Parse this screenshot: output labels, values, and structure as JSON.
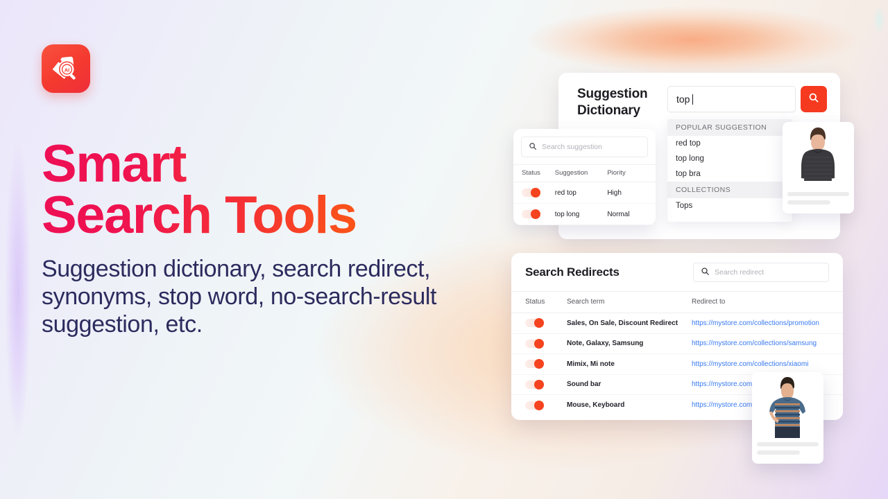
{
  "brand": {
    "logo_icon": "tag-ai-search-icon",
    "logo_bg": "#F4392F"
  },
  "hero": {
    "headline_line1": "Smart",
    "headline_line2": "Search Tools",
    "headline_gradient_from": "#EE0F55",
    "headline_gradient_to": "#FB5517",
    "subheadline": "Suggestion dictionary, search redirect, synonyms, stop word, no-search-result suggestion, etc.",
    "subheadline_color": "#2C2B5E"
  },
  "suggestion_dictionary": {
    "title_line1": "Suggestion",
    "title_line2": "Dictionary",
    "storefront_search": {
      "value": "top",
      "button_icon": "search-icon",
      "button_color": "#F53A20"
    },
    "dropdown": {
      "sections": [
        {
          "heading": "POPULAR SUGGESTION",
          "items": [
            "red top",
            "top long",
            "top bra"
          ]
        },
        {
          "heading": "COLLECTIONS",
          "items": [
            "Tops"
          ]
        }
      ]
    },
    "table": {
      "search_placeholder": "Search suggestion",
      "search_icon": "search-icon",
      "columns": [
        "Status",
        "Suggestion",
        "Piority"
      ],
      "rows": [
        {
          "status": "on",
          "suggestion": "red top",
          "priority": "High"
        },
        {
          "status": "on",
          "suggestion": "top long",
          "priority": "Normal"
        }
      ]
    }
  },
  "search_redirects": {
    "title": "Search Redirects",
    "search_placeholder": "Search redirect",
    "search_icon": "search-icon",
    "columns": [
      "Status",
      "Search term",
      "Redirect to"
    ],
    "rows": [
      {
        "status": "on",
        "term": "Sales, On Sale, Discount Redirect",
        "url": "https://mystore.com/collections/promotion"
      },
      {
        "status": "on",
        "term": "Note, Galaxy, Samsung",
        "url": "https://mystore.com/collections/samsung"
      },
      {
        "status": "on",
        "term": "Mimix, Mi note",
        "url": "https://mystore.com/collections/xiaomi"
      },
      {
        "status": "on",
        "term": "Sound bar",
        "url": "https://mystore.com/"
      },
      {
        "status": "on",
        "term": "Mouse, Keyboard",
        "url": "https://mystore.com/"
      }
    ],
    "link_color": "#3779F0"
  },
  "product_cards": [
    {
      "name": "woman-in-dark-top",
      "image": "model-photo"
    },
    {
      "name": "man-in-striped-polo",
      "image": "model-photo"
    }
  ]
}
